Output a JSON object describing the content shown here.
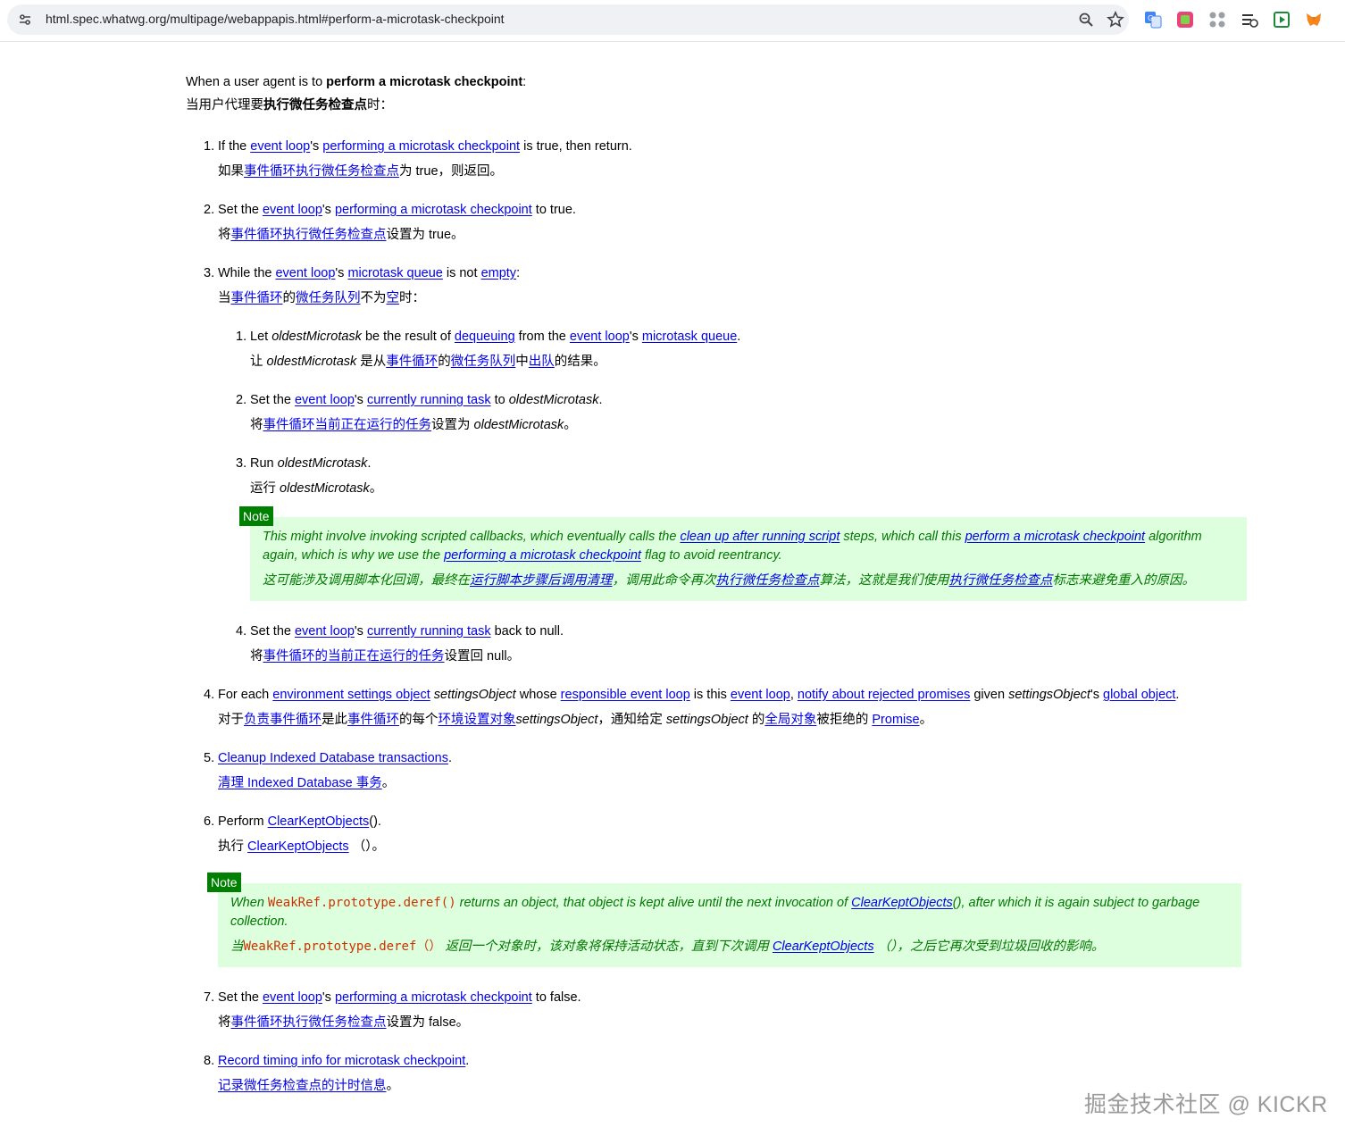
{
  "browser": {
    "url": "html.spec.whatwg.org/multipage/webappapis.html#perform-a-microtask-checkpoint",
    "icons": [
      "tune-icon",
      "zoom-icon",
      "bookmark-star-icon",
      "translate-extension-icon",
      "colorful-extension-icon",
      "grid-extension-icon",
      "list-extension-icon",
      "video-extension-icon",
      "metamask-fox-icon"
    ]
  },
  "intro": {
    "en_pre": "When a user agent is to ",
    "en_bold": "perform a microtask checkpoint",
    "en_post": ":",
    "zh_pre": "当用户代理要",
    "zh_bold": "执行微任务检查点",
    "zh_post": "时："
  },
  "common": {
    "event_loop": "event loop",
    "performing_checkpoint": "performing a microtask checkpoint",
    "microtask_queue": "microtask queue",
    "currently_running_task": "currently running task",
    "zh_event_loop_performing": "事件循环执行微任务检查点",
    "oldest": "oldestMicrotask"
  },
  "steps": {
    "s1": {
      "num": "1.",
      "en_pre": "If the ",
      "en_mid": "'s ",
      "en_post": " is true, then return.",
      "zh_pre": "如果",
      "zh_post": "为 true，则返回。"
    },
    "s2": {
      "num": "2.",
      "en_pre": "Set the ",
      "en_mid": "'s ",
      "en_post": " to true.",
      "zh_pre": "将",
      "zh_post": "设置为 true。"
    },
    "s3": {
      "num": "3.",
      "en_pre": "While the ",
      "en_mid": "'s ",
      "en_mid2": " is not ",
      "empty": "empty",
      "en_post": ":",
      "zh_pre": "当",
      "zh_link1": "事件循环",
      "zh_mid": "的",
      "zh_link2": "微任务队列",
      "zh_mid2": "不为",
      "zh_link3": "空",
      "zh_post": "时："
    },
    "s3_1": {
      "num": "1.",
      "en_pre": "Let ",
      "en_mid": " be the result of ",
      "dequeuing": "dequeuing",
      "en_mid2": " from the ",
      "en_mid3": "'s ",
      "en_post": ".",
      "zh_pre": "让 ",
      "zh_mid": " 是从",
      "zh_link1": "事件循环",
      "zh_mid2": "的",
      "zh_link2": "微任务队列",
      "zh_mid3": "中",
      "zh_link3": "出队",
      "zh_post": "的结果。"
    },
    "s3_2": {
      "num": "2.",
      "en_pre": "Set the ",
      "en_mid": "'s ",
      "en_mid2": " to ",
      "en_post": ".",
      "zh_pre": "将",
      "zh_link": "事件循环当前正在运行的任务",
      "zh_mid": "设置为 ",
      "zh_post": "。"
    },
    "s3_3": {
      "num": "3.",
      "en_pre": "Run ",
      "en_post": ".",
      "zh_pre": "运行 ",
      "zh_post": "。"
    },
    "note1": {
      "tag": "Note",
      "en_pre": "This might involve invoking scripted callbacks, which eventually calls the ",
      "link1": "clean up after running script",
      "en_mid": " steps, which call this ",
      "link2": "perform a microtask checkpoint",
      "en_mid2": " algorithm again, which is why we use the ",
      "link3": "performing a microtask checkpoint",
      "en_post": " flag to avoid reentrancy.",
      "zh_pre": "这可能涉及调用脚本化回调，最终在",
      "zh_link1": "运行脚本步骤后调用清理",
      "zh_mid": "，调用此命令再次",
      "zh_link2": "执行微任务检查点",
      "zh_mid2": "算法，这就是我们使用",
      "zh_link3": "执行微任务检查点",
      "zh_post": "标志来避免重入的原因。"
    },
    "s3_4": {
      "num": "4.",
      "en_pre": "Set the ",
      "en_mid": "'s ",
      "en_post": " back to null.",
      "zh_pre": "将",
      "zh_link": "事件循环的当前正在运行的任务",
      "zh_post": "设置回 null。"
    },
    "s4": {
      "num": "4.",
      "en_pre": "For each ",
      "link1": "environment settings object",
      "var": "settingsObject",
      "en_mid": " whose ",
      "link2": "responsible event loop",
      "en_mid2": " is this ",
      "en_mid3": ", ",
      "link4": "notify about rejected promises",
      "en_mid4": " given ",
      "en_mid5": "'s ",
      "link5": "global object",
      "en_post": ".",
      "zh_pre": "对于",
      "zh_link1": "负责事件循环",
      "zh_mid": "是此",
      "zh_link2": "事件循环",
      "zh_mid2": "的每个",
      "zh_link3": "环境设置对象",
      "zh_mid3": "，通知给定 ",
      "zh_mid4": " 的",
      "zh_link4": "全局对象",
      "zh_mid5": "被拒绝的 ",
      "zh_link5": "Promise",
      "zh_post": "。"
    },
    "s5": {
      "num": "5.",
      "link": "Cleanup Indexed Database transactions",
      "en_post": ".",
      "zh_link": "清理 Indexed Database 事务",
      "zh_post": "。"
    },
    "s6": {
      "num": "6.",
      "en_pre": "Perform ",
      "link": "ClearKeptObjects",
      "en_post": "().",
      "zh_pre": "执行 ",
      "zh_link": "ClearKeptObjects",
      "zh_post": " （）。"
    },
    "note2": {
      "tag": "Note",
      "en_pre": "When ",
      "code": "WeakRef.prototype.deref()",
      "en_mid": " returns an object, that object is kept alive until the next invocation of ",
      "link": "ClearKeptObjects",
      "en_post": "(), after which it is again subject to garbage collection.",
      "zh_pre": "当",
      "zh_code": "WeakRef.prototype.deref（）",
      "zh_mid": " 返回一个对象时，该对象将保持活动状态，直到下次调用 ",
      "zh_link": "ClearKeptObjects",
      "zh_post": " （），之后它再次受到垃圾回收的影响。"
    },
    "s7": {
      "num": "7.",
      "en_pre": "Set the ",
      "en_mid": "'s ",
      "en_post": " to false.",
      "zh_pre": "将",
      "zh_post": "设置为 false。"
    },
    "s8": {
      "num": "8.",
      "link": "Record timing info for microtask checkpoint",
      "en_post": ".",
      "zh_link": "记录微任务检查点的计时信息",
      "zh_post": "。"
    }
  },
  "watermark": "掘金技术社区 @ KICKR",
  "colors": {
    "link": "#0000ee",
    "visited": "#551a8b",
    "note_bg": "#ddffdd",
    "note_text": "#007700",
    "note_tag": "#008000",
    "code": "#cc3300"
  }
}
